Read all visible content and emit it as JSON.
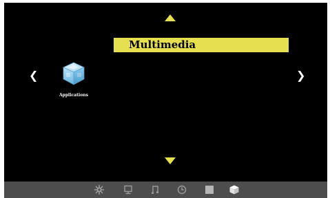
{
  "menu": {
    "title": "Multimedia",
    "nav_left_glyph": "❮",
    "nav_right_glyph": "❯"
  },
  "apps": [
    {
      "label": "Applications",
      "icon": "cube-icon"
    }
  ],
  "taskbar": {
    "icons": [
      "gear-icon",
      "monitor-icon",
      "music-note-icon",
      "clock-icon",
      "square-icon",
      "cube-icon"
    ]
  },
  "colors": {
    "accent": "#e6e050",
    "background": "#000000",
    "taskbar": "#4d4d4d",
    "taskbar_icon": "#9a9a9a"
  }
}
